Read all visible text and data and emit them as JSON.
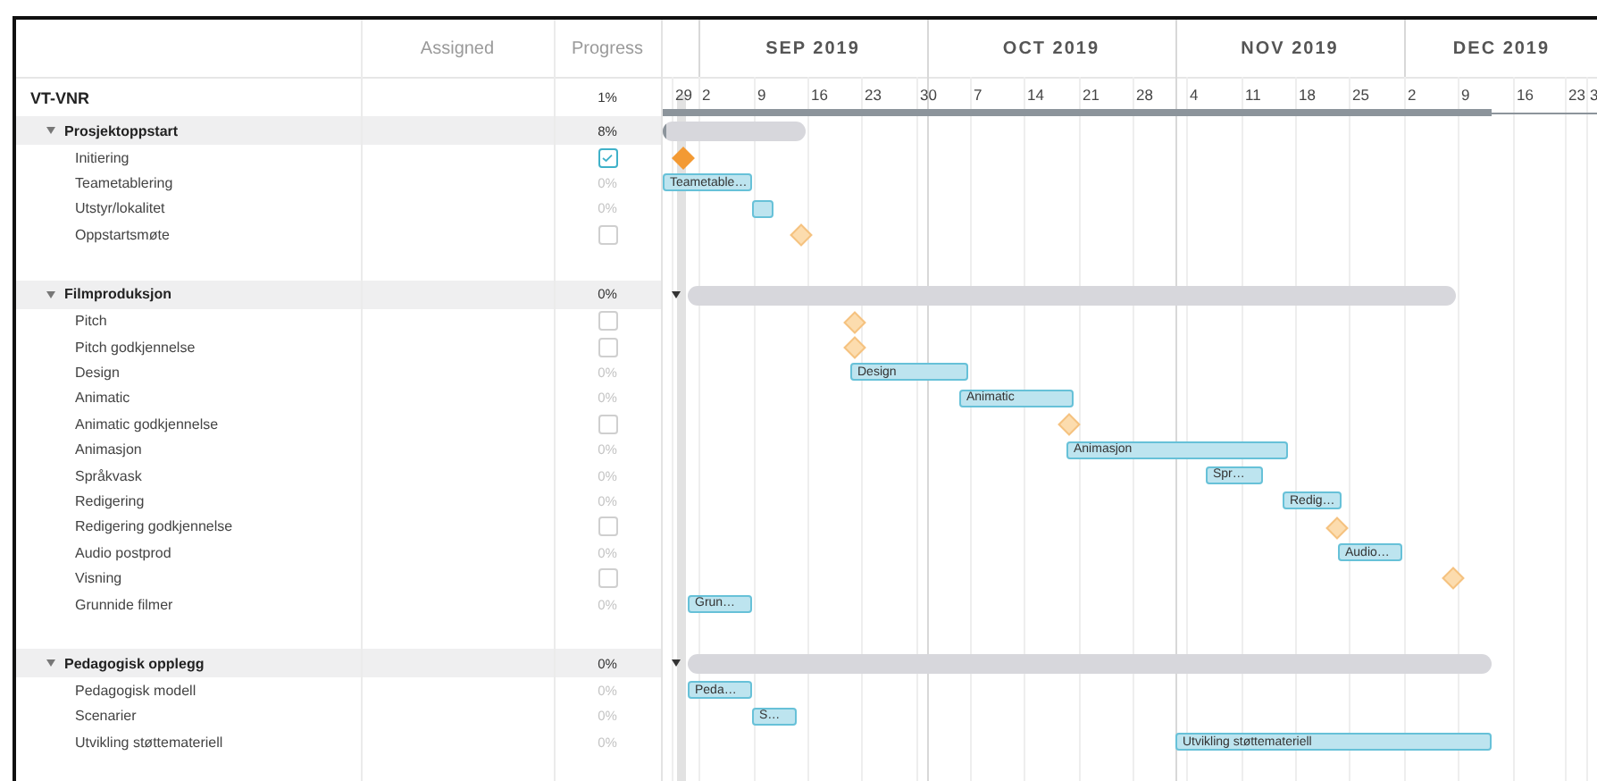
{
  "columns": [
    "Assigned",
    "Progress"
  ],
  "months": [
    "SEP 2019",
    "OCT 2019",
    "NOV 2019",
    "DEC 2019"
  ],
  "weeks": [
    "29",
    "2",
    "9",
    "16",
    "23",
    "30",
    "7",
    "14",
    "21",
    "28",
    "4",
    "11",
    "18",
    "25",
    "2",
    "9",
    "16",
    "23",
    "3"
  ],
  "project": {
    "name": "VT-VNR",
    "progress": "1%"
  },
  "groups": [
    {
      "name": "Prosjektoppstart",
      "progress": "8%",
      "expanded": true,
      "tasks": [
        {
          "name": "Initiering",
          "kind": "milestone",
          "checked": true
        },
        {
          "name": "Teametablering",
          "kind": "task",
          "progress": "0%",
          "bar_label": "Teametable…"
        },
        {
          "name": "Utstyr/lokalitet",
          "kind": "task",
          "progress": "0%"
        },
        {
          "name": "Oppstartsmøte",
          "kind": "milestone",
          "checked": false
        }
      ]
    },
    {
      "name": "Filmproduksjon",
      "progress": "0%",
      "expanded": true,
      "tasks": [
        {
          "name": "Pitch",
          "kind": "milestone",
          "checked": false
        },
        {
          "name": "Pitch godkjennelse",
          "kind": "milestone",
          "checked": false
        },
        {
          "name": "Design",
          "kind": "task",
          "progress": "0%",
          "bar_label": "Design"
        },
        {
          "name": "Animatic",
          "kind": "task",
          "progress": "0%",
          "bar_label": "Animatic"
        },
        {
          "name": "Animatic godkjennelse",
          "kind": "milestone",
          "checked": false
        },
        {
          "name": "Animasjon",
          "kind": "task",
          "progress": "0%",
          "bar_label": "Animasjon"
        },
        {
          "name": "Språkvask",
          "kind": "task",
          "progress": "0%",
          "bar_label": "Spr…"
        },
        {
          "name": "Redigering",
          "kind": "task",
          "progress": "0%",
          "bar_label": "Redig…"
        },
        {
          "name": "Redigering godkjennelse",
          "kind": "milestone",
          "checked": false
        },
        {
          "name": "Audio postprod",
          "kind": "task",
          "progress": "0%",
          "bar_label": "Audio…"
        },
        {
          "name": "Visning",
          "kind": "milestone",
          "checked": false
        },
        {
          "name": "Grunnide filmer",
          "kind": "task",
          "progress": "0%",
          "bar_label": "Grun…"
        }
      ]
    },
    {
      "name": "Pedagogisk opplegg",
      "progress": "0%",
      "expanded": true,
      "tasks": [
        {
          "name": "Pedagogisk modell",
          "kind": "task",
          "progress": "0%",
          "bar_label": "Peda…"
        },
        {
          "name": "Scenarier",
          "kind": "task",
          "progress": "0%",
          "bar_label": "S…"
        },
        {
          "name": "Utvikling støttemateriell",
          "kind": "task",
          "progress": "0%",
          "bar_label": "Utvikling støttemateriell"
        }
      ]
    }
  ]
}
